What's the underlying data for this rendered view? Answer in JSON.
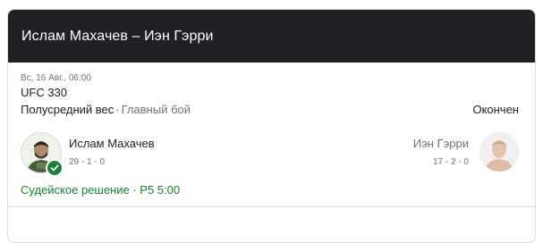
{
  "header": {
    "title": "Ислам Махачев – Иэн Гэрри"
  },
  "match": {
    "date": "Вс, 16 Авг., 06:00",
    "event": "UFC 330",
    "weight_class": "Полусредний вес",
    "separator": "·",
    "bout_type": "Главный бой",
    "status": "Окончен",
    "result": "Судейское решение · Р5 5:00"
  },
  "fighters": {
    "left": {
      "name": "Ислам Махачев",
      "record": "29 - 1 - 0",
      "winner": true,
      "avatar_icon": "fighter-photo-icon"
    },
    "right": {
      "name": "Иэн Гэрри",
      "record": "17 - 2 - 0",
      "winner": false,
      "avatar_icon": "fighter-photo-icon"
    }
  },
  "colors": {
    "header_bg": "#202124",
    "winner_green": "#188038",
    "muted_text": "#70757a"
  }
}
